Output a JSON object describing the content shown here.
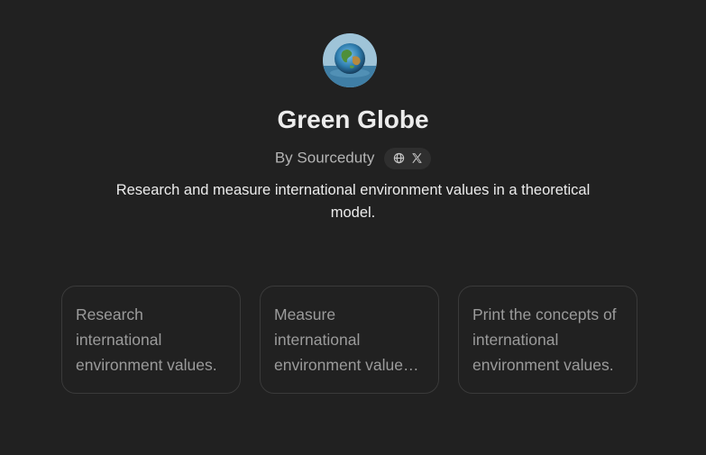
{
  "gpt": {
    "name": "Green Globe",
    "by_label": "By Sourceduty",
    "description": "Research and measure international environment values in a theoretical model."
  },
  "socials": [
    {
      "icon": "globe-icon"
    },
    {
      "icon": "x-logo-icon"
    }
  ],
  "starters": [
    {
      "text": "Research international environment values."
    },
    {
      "text": "Measure international environment values in a theoretical model."
    },
    {
      "text": "Print the concepts of international environment values."
    }
  ],
  "colors": {
    "background": "#212121",
    "title": "#ececec",
    "muted": "#b4b4b4",
    "card_border": "#3a3a3a",
    "card_text": "#9b9b9b"
  }
}
